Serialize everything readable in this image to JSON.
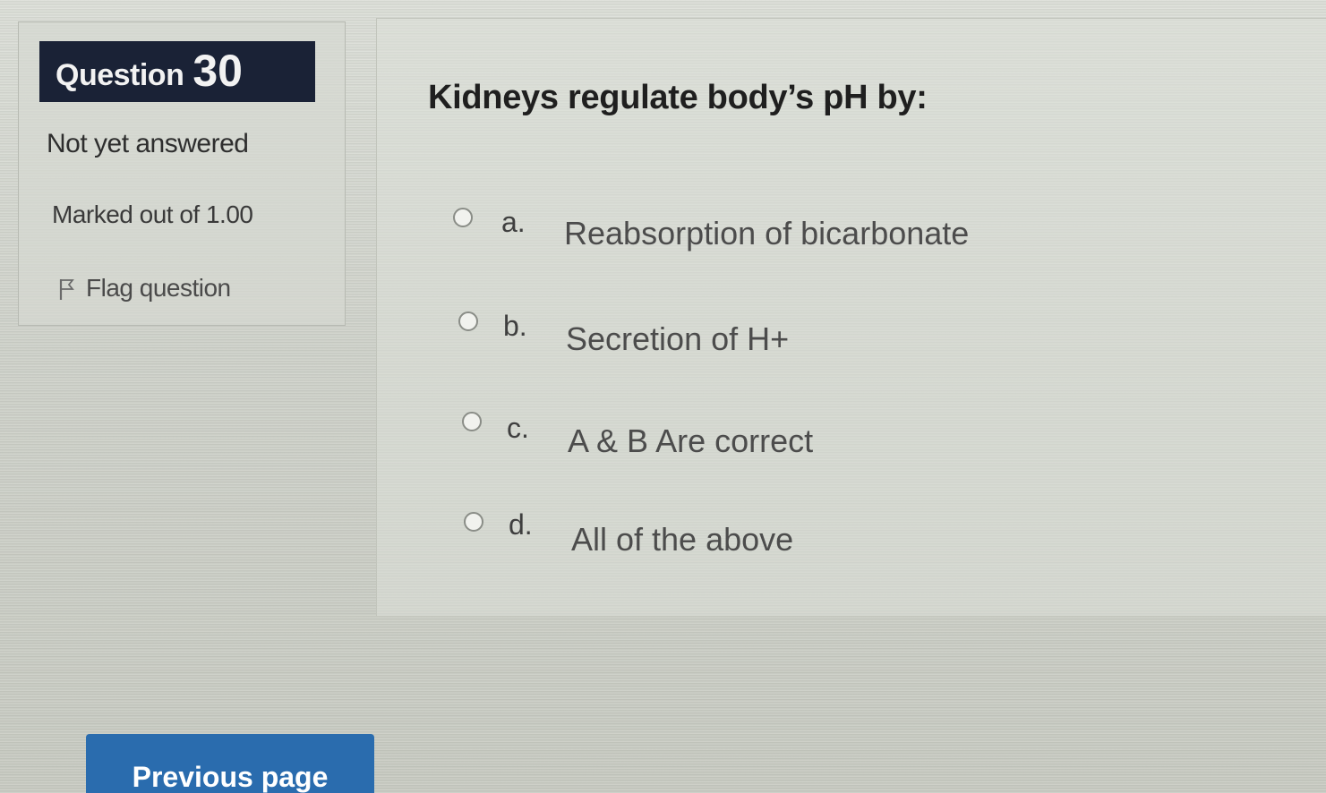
{
  "question_info": {
    "label": "Question",
    "number": "30",
    "state": "Not yet answered",
    "grade": "Marked out of 1.00",
    "flag_label": "Flag question"
  },
  "question": {
    "text": "Kidneys regulate body’s pH by:",
    "options": [
      {
        "letter": "a.",
        "text": "Reabsorption of bicarbonate",
        "selected": false
      },
      {
        "letter": "b.",
        "text": "Secretion of H+",
        "selected": false
      },
      {
        "letter": "c.",
        "text": "A & B Are correct",
        "selected": false
      },
      {
        "letter": "d.",
        "text": "All of the above",
        "selected": false
      }
    ]
  },
  "navigation": {
    "previous_label": "Previous page"
  },
  "colors": {
    "question_number_bg": "#1a2236",
    "primary_button": "#2a6cae"
  }
}
